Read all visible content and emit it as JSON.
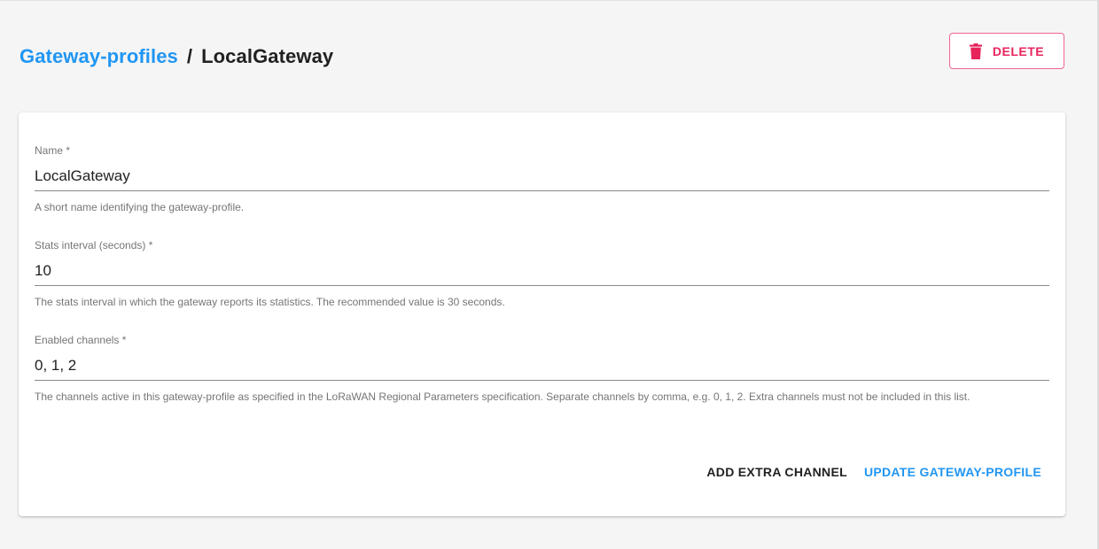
{
  "breadcrumb": {
    "parent": "Gateway-profiles",
    "separator": "/",
    "current": "LocalGateway"
  },
  "delete_button": {
    "label": "DELETE",
    "icon": "trash-icon"
  },
  "form": {
    "name": {
      "label": "Name *",
      "value": "LocalGateway",
      "help": "A short name identifying the gateway-profile."
    },
    "stats_interval": {
      "label": "Stats interval (seconds) *",
      "value": "10",
      "help": "The stats interval in which the gateway reports its statistics. The recommended value is 30 seconds."
    },
    "enabled_channels": {
      "label": "Enabled channels *",
      "value": "0, 1, 2",
      "help": "The channels active in this gateway-profile as specified in the LoRaWAN Regional Parameters specification. Separate channels by comma, e.g. 0, 1, 2. Extra channels must not be included in this list."
    }
  },
  "actions": {
    "add_extra_channel": "ADD EXTRA CHANNEL",
    "update": "UPDATE GATEWAY-PROFILE"
  },
  "colors": {
    "primary": "#2196f3",
    "danger": "#e8245c",
    "background": "#f5f5f5"
  }
}
